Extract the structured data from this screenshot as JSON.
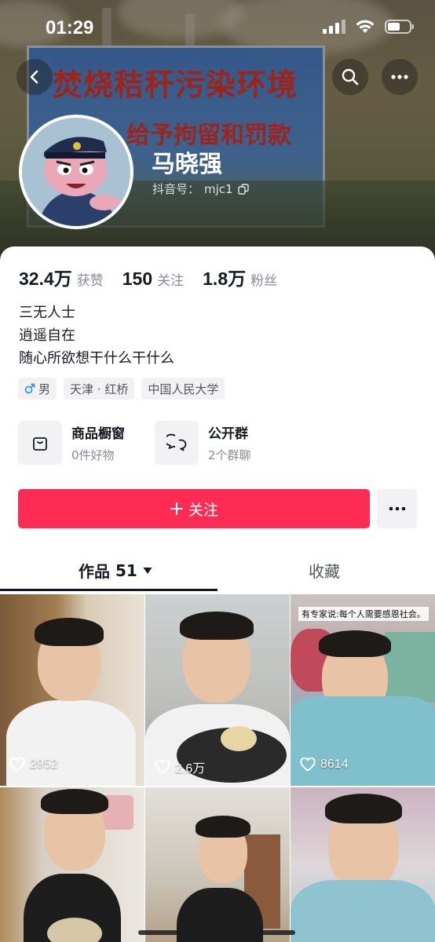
{
  "status_bar": {
    "time": "01:29"
  },
  "banner": {
    "sign_line1": "焚烧秸秆污染环境",
    "sign_line2": "给予拘留和罚款"
  },
  "profile": {
    "name": "马晓强",
    "douyin_id_label": "抖音号：",
    "douyin_id": "mjc1"
  },
  "stats": [
    {
      "value": "32.4万",
      "label": "获赞"
    },
    {
      "value": "150",
      "label": "关注"
    },
    {
      "value": "1.8万",
      "label": "粉丝"
    }
  ],
  "bio": [
    "三无人士",
    "逍遥自在",
    "随心所欲想干什么干什么"
  ],
  "tags": [
    {
      "icon": "male-icon",
      "label": "男"
    },
    {
      "label": "天津 · 红桥"
    },
    {
      "label": "中国人民大学"
    }
  ],
  "features": [
    {
      "icon": "shopping-bag-icon",
      "title": "商品橱窗",
      "subtitle": "0件好物"
    },
    {
      "icon": "group-chat-icon",
      "title": "公开群",
      "subtitle": "2个群聊"
    }
  ],
  "follow_button": {
    "label": "关注",
    "color": "#fe2c55"
  },
  "tabs": {
    "works_label": "作品",
    "works_count": "51",
    "favorites_label": "收藏"
  },
  "videos": [
    {
      "likes": "2952"
    },
    {
      "likes": "2.6万"
    },
    {
      "likes": "8614",
      "caption": "有专家说:每个人需要感恩社会。"
    },
    {
      "likes": ""
    },
    {
      "likes": ""
    },
    {
      "likes": ""
    }
  ]
}
